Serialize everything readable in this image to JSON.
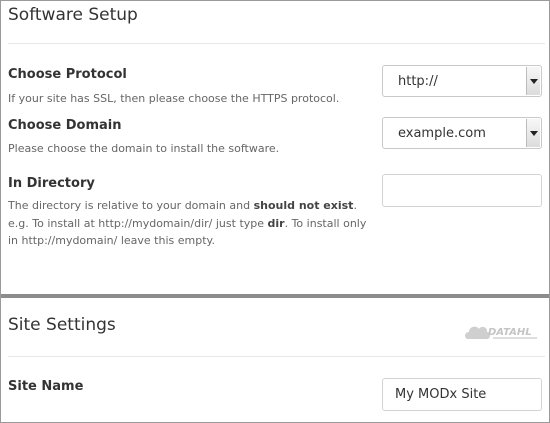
{
  "software_setup": {
    "title": "Software Setup",
    "protocol": {
      "label": "Choose Protocol",
      "help": "If your site has SSL, then please choose the HTTPS protocol.",
      "value": "http://"
    },
    "domain": {
      "label": "Choose Domain",
      "help": "Please choose the domain to install the software.",
      "value": "example.com"
    },
    "directory": {
      "label": "In Directory",
      "help_1": "The directory is relative to your domain and ",
      "help_bold_1": "should not exist",
      "help_2": ". e.g. To install at http://mydomain/dir/ just type ",
      "help_bold_2": "dir",
      "help_3": ". To install only in http://mydomain/ leave this empty.",
      "value": ""
    }
  },
  "site_settings": {
    "title": "Site Settings",
    "logo_text": "DATAHL",
    "site_name": {
      "label": "Site Name",
      "value": "My MODx Site"
    }
  }
}
